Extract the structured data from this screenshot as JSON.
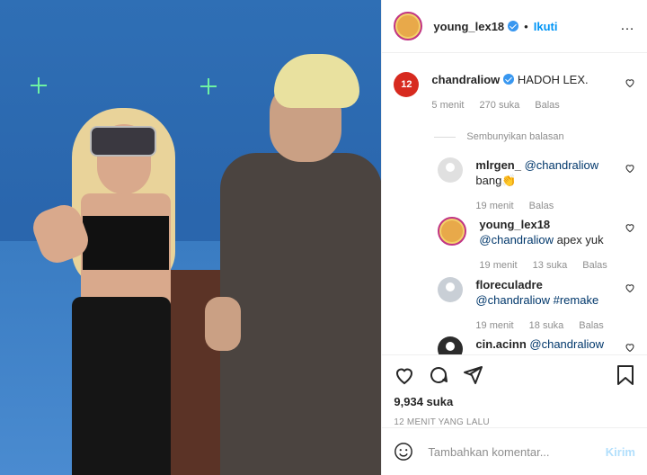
{
  "post": {
    "author": "young_lex18",
    "separator": "•",
    "follow_label": "Ikuti",
    "more_icon": "…"
  },
  "comments": [
    {
      "user": "chandraliow",
      "avatar_text": "12",
      "verified": true,
      "text": "HADOH LEX.",
      "time": "5 menit",
      "likes": "270 suka",
      "reply_label": "Balas"
    }
  ],
  "hide_replies_label": "Sembunyikan balasan",
  "replies": [
    {
      "user": "mlrgen_",
      "mention": "@chandraliow",
      "text": "bang👏",
      "time": "19 menit",
      "likes": "",
      "reply_label": "Balas"
    },
    {
      "user": "young_lex18",
      "mention": "@chandraliow",
      "text": "apex yuk",
      "time": "19 menit",
      "likes": "13 suka",
      "reply_label": "Balas"
    },
    {
      "user": "floreculadre",
      "mention": "@chandraliow",
      "text": "#remake",
      "time": "19 menit",
      "likes": "18 suka",
      "reply_label": "Balas"
    },
    {
      "user": "cin.acinn",
      "mention": "@chandraliow",
      "text": "",
      "time": "",
      "likes": "",
      "reply_label": ""
    }
  ],
  "footer": {
    "likes": "9,934 suka",
    "timestamp": "12 MENIT YANG LALU",
    "comment_placeholder": "Tambahkan komentar...",
    "send_label": "Kirim"
  }
}
